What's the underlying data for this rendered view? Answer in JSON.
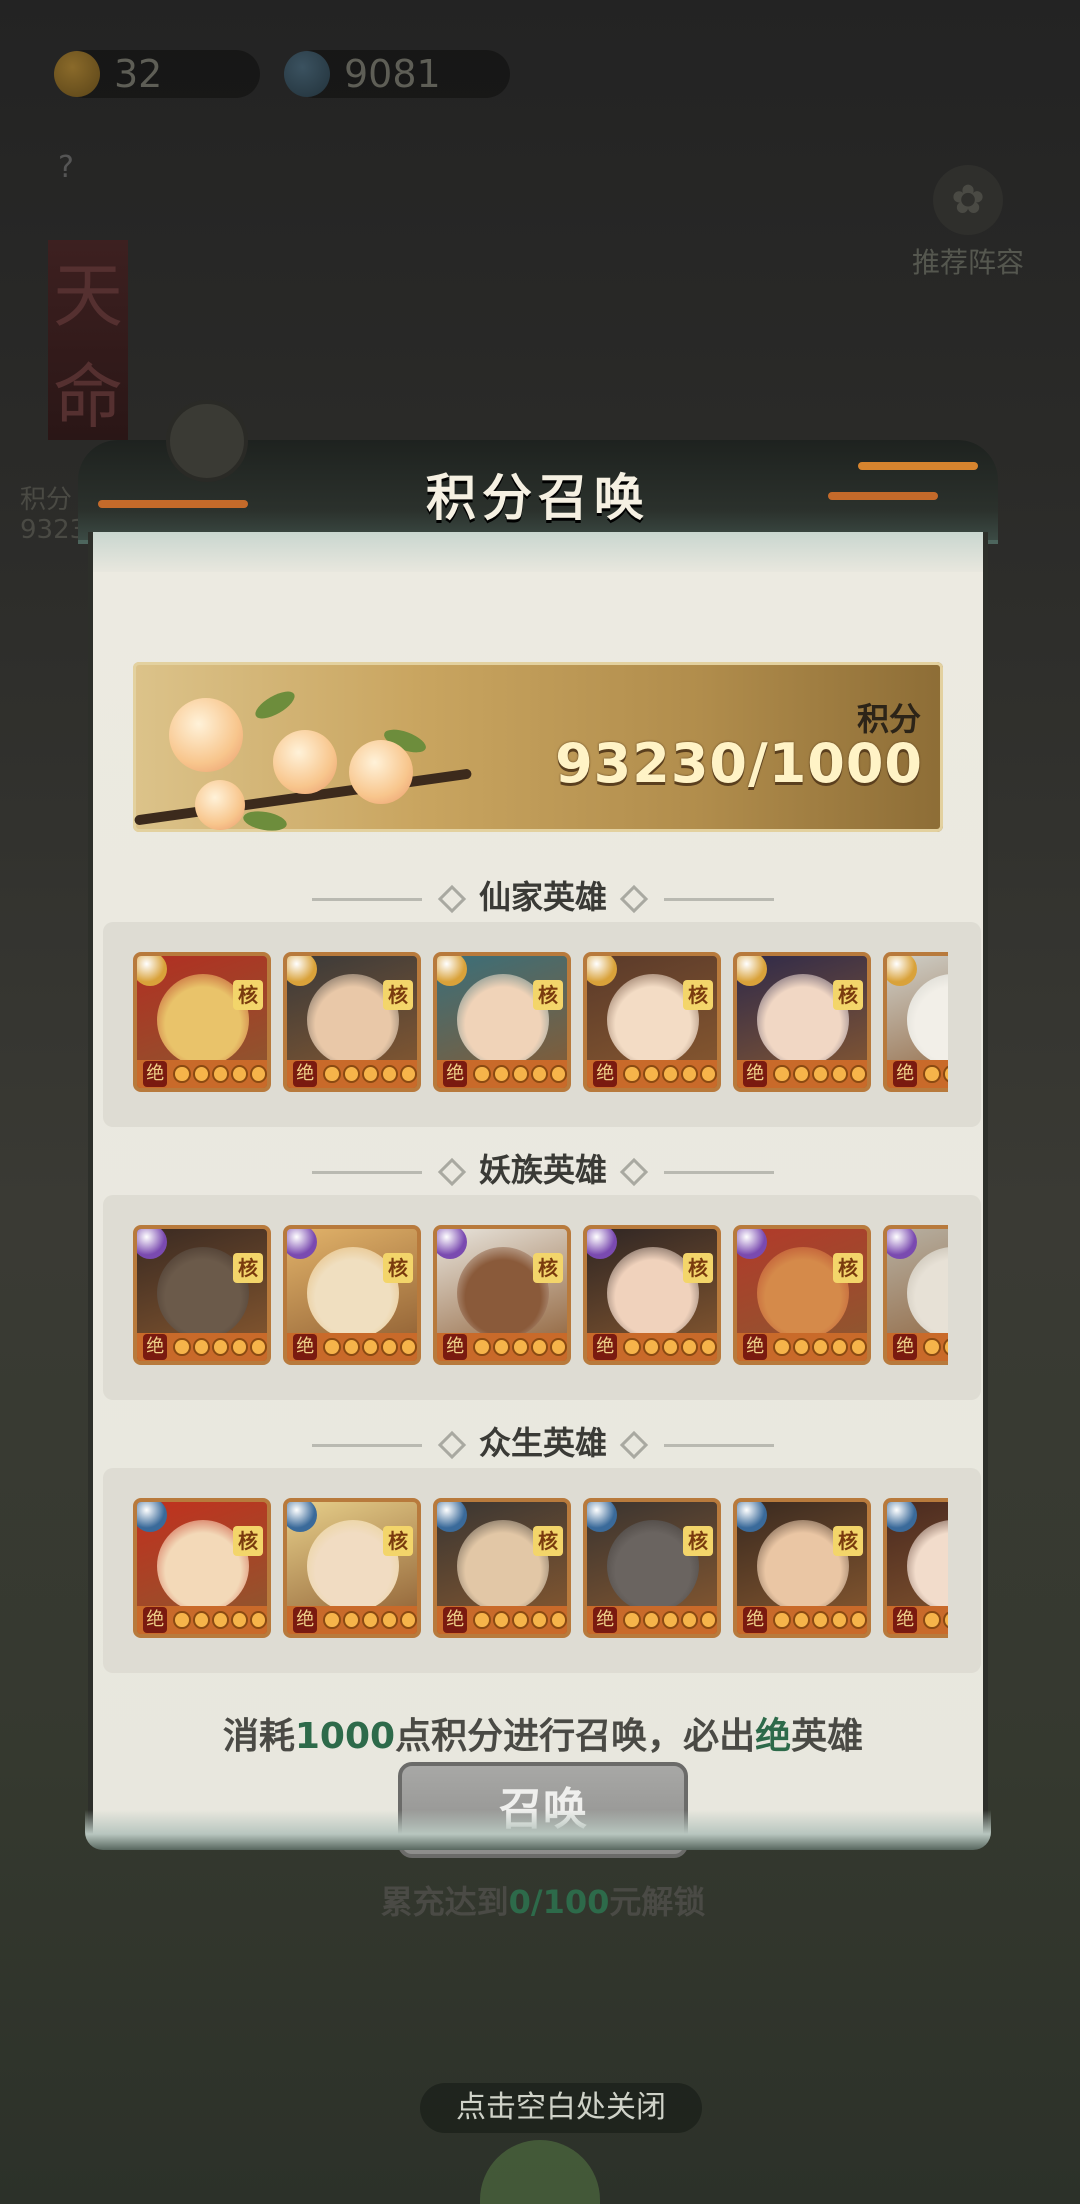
{
  "background": {
    "currency": [
      {
        "icon": "peach-icon",
        "value": "32"
      },
      {
        "icon": "spirit-icon",
        "value": "9081"
      }
    ],
    "help_label": "?",
    "recommend_label": "推荐阵容",
    "left_banner_text": "天命",
    "left_score_label": "积分",
    "left_score_value": "9323"
  },
  "dialog": {
    "title": "积分召唤",
    "score": {
      "label": "积分",
      "value": "93230/1000"
    },
    "sections": [
      {
        "title": "仙家英雄",
        "gem_color": "#d9a23a",
        "heroes": [
          {
            "face": "#e9c36a",
            "accent": "#b22f22"
          },
          {
            "face": "#e9c8a8",
            "accent": "#3a3a3a"
          },
          {
            "face": "#f0d3b8",
            "accent": "#3a6f7a"
          },
          {
            "face": "#f3dcc5",
            "accent": "#5a3a2a"
          },
          {
            "face": "#f1d7c4",
            "accent": "#2f2a4a"
          },
          {
            "face": "#f2efe8",
            "accent": "#cfcfc8"
          }
        ]
      },
      {
        "title": "妖族英雄",
        "gem_color": "#7a4ab0",
        "heroes": [
          {
            "face": "#6b5a4a",
            "accent": "#3a2a22"
          },
          {
            "face": "#f0dfc0",
            "accent": "#e2b36a"
          },
          {
            "face": "#8a5a3a",
            "accent": "#e8e4dc"
          },
          {
            "face": "#f0d2bc",
            "accent": "#2f2624"
          },
          {
            "face": "#d58a4a",
            "accent": "#b23a2a"
          },
          {
            "face": "#e7e1d6",
            "accent": "#b7b0a2"
          }
        ]
      },
      {
        "title": "众生英雄",
        "gem_color": "#3a6a9a",
        "heroes": [
          {
            "face": "#f3d9b8",
            "accent": "#c2301e"
          },
          {
            "face": "#f1dcc2",
            "accent": "#e7cf8a"
          },
          {
            "face": "#e2c7a6",
            "accent": "#3a3632"
          },
          {
            "face": "#6a6460",
            "accent": "#3a3430"
          },
          {
            "face": "#eac6a4",
            "accent": "#3a2a20"
          },
          {
            "face": "#f2dccb",
            "accent": "#4a2a20"
          }
        ]
      }
    ],
    "hero_tag": "核",
    "hero_rank": "绝",
    "info": {
      "prefix": "消耗",
      "cost": "1000",
      "middle": "点积分进行召唤，必出",
      "grade": "绝",
      "suffix": "英雄"
    },
    "summon_label": "召唤",
    "unlock": {
      "prefix": "累充达到",
      "current": "0",
      "sep": "/",
      "target": "100",
      "suffix": "元解锁"
    }
  },
  "close_hint": "点击空白处关闭"
}
